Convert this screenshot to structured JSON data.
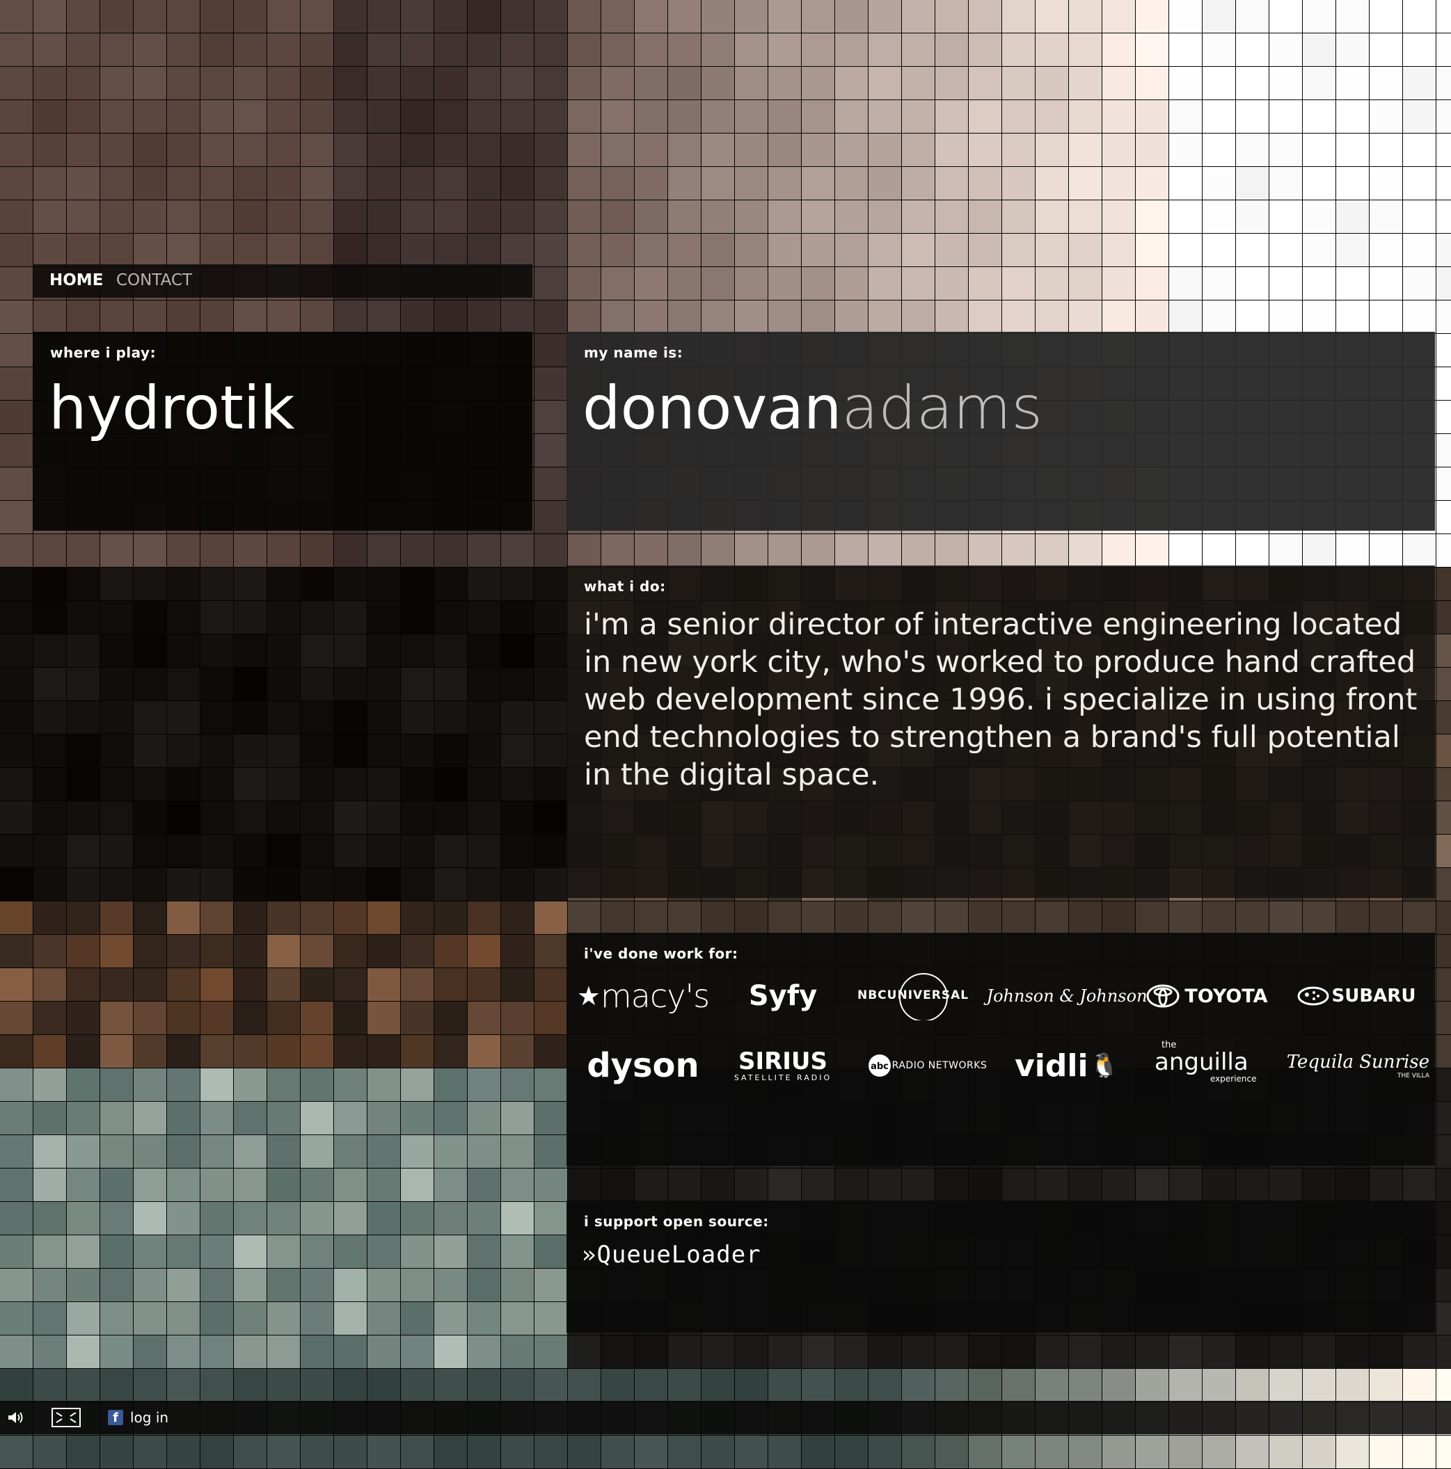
{
  "nav": {
    "home": "HOME",
    "contact": "CONTACT"
  },
  "play": {
    "label": "where i play:",
    "value": "hydrotik"
  },
  "name": {
    "label": "my name is:",
    "first": "donovan",
    "last": "adams"
  },
  "whatido": {
    "label": "what i do:",
    "body": "i'm a senior director of interactive engineering located in new york city, who's worked to produce hand crafted web development since 1996. i specialize in using front end technologies to strengthen a brand's full potential in the digital space."
  },
  "clients": {
    "label": "i've done work for:",
    "logos": [
      "macy's",
      "Syfy",
      "NBCUNIVERSAL",
      "Johnson & Johnson",
      "TOYOTA",
      "SUBARU",
      "dyson",
      "SIRIUS",
      "SATELLITE RADIO",
      "RADIO NETWORKS",
      "vidli",
      "anguilla",
      "the",
      "experience",
      "Tequila Sunrise",
      "THE VILLA"
    ]
  },
  "opensource": {
    "label": "i support open source:",
    "project": "QueueLoader"
  },
  "footer": {
    "login": "log in"
  },
  "colors": {
    "accent": "#ffffff",
    "facebook": "#3b5998"
  },
  "icons": [
    "speaker-icon",
    "fullscreen-icon",
    "facebook-icon"
  ]
}
